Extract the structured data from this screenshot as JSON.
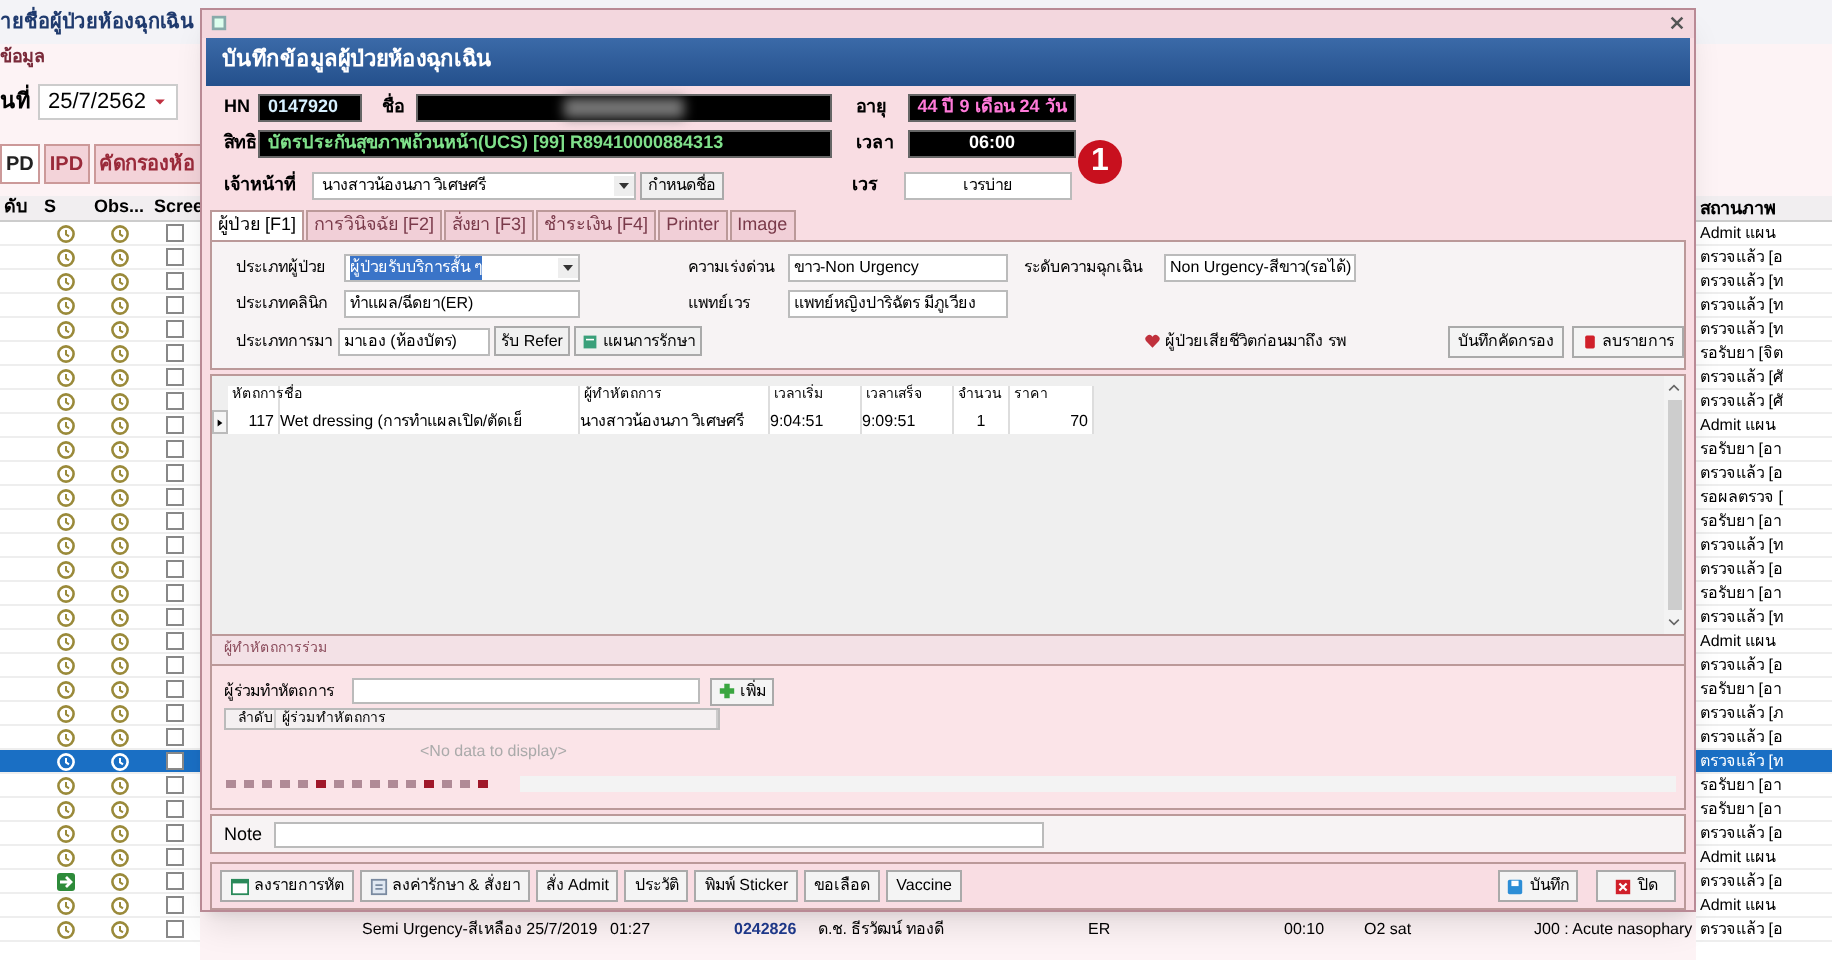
{
  "app": {
    "title": "ายชื่อผู้ป่วยห้องฉุกเฉิน",
    "menu": "ข้อมูล",
    "date_label": "นที่",
    "date": "25/7/2562",
    "tabs": [
      {
        "label": "PD",
        "selected": true
      },
      {
        "label": "IPD",
        "selected": false
      },
      {
        "label": "คัดกรองห้อ",
        "selected": false
      }
    ],
    "columns": [
      "ดับ",
      "S",
      "Obs...",
      "Scree"
    ],
    "status_column": "สถานภาพ",
    "rows": [
      {
        "kind": "clock",
        "checked": false,
        "selected": false,
        "status": "Admit แผน"
      },
      {
        "kind": "clock",
        "checked": false,
        "selected": false,
        "status": "ตรวจแล้ว [อ"
      },
      {
        "kind": "clock",
        "checked": false,
        "selected": false,
        "status": "ตรวจแล้ว [ท"
      },
      {
        "kind": "clock",
        "checked": false,
        "selected": false,
        "status": "ตรวจแล้ว [ท"
      },
      {
        "kind": "clock",
        "checked": false,
        "selected": false,
        "status": "ตรวจแล้ว [ท"
      },
      {
        "kind": "clock",
        "checked": false,
        "selected": false,
        "status": "รอรับยา [จิต"
      },
      {
        "kind": "clock",
        "checked": false,
        "selected": false,
        "status": "ตรวจแล้ว [ศั"
      },
      {
        "kind": "clock",
        "checked": false,
        "selected": false,
        "status": "ตรวจแล้ว [ศั"
      },
      {
        "kind": "clock",
        "checked": false,
        "selected": false,
        "status": "Admit แผน"
      },
      {
        "kind": "clock",
        "checked": false,
        "selected": false,
        "status": "รอรับยา [อา"
      },
      {
        "kind": "clock",
        "checked": false,
        "selected": false,
        "status": "ตรวจแล้ว [อ"
      },
      {
        "kind": "clock",
        "checked": false,
        "selected": false,
        "status": "รอผลตรวจ ["
      },
      {
        "kind": "clock",
        "checked": false,
        "selected": false,
        "status": "รอรับยา [อา"
      },
      {
        "kind": "clock",
        "checked": false,
        "selected": false,
        "status": "ตรวจแล้ว [ท"
      },
      {
        "kind": "clock",
        "checked": false,
        "selected": false,
        "status": "ตรวจแล้ว [อ"
      },
      {
        "kind": "clock",
        "checked": false,
        "selected": false,
        "status": "รอรับยา [อา"
      },
      {
        "kind": "clock",
        "checked": false,
        "selected": false,
        "status": "ตรวจแล้ว [ท"
      },
      {
        "kind": "clock",
        "checked": false,
        "selected": false,
        "status": "Admit แผน"
      },
      {
        "kind": "clock",
        "checked": false,
        "selected": false,
        "status": "ตรวจแล้ว [อ"
      },
      {
        "kind": "clock",
        "checked": false,
        "selected": false,
        "status": "รอรับยา [อา"
      },
      {
        "kind": "clock",
        "checked": false,
        "selected": false,
        "status": "ตรวจแล้ว [ภ"
      },
      {
        "kind": "clock",
        "checked": false,
        "selected": false,
        "status": "ตรวจแล้ว [อ"
      },
      {
        "kind": "clock",
        "checked": false,
        "selected": true,
        "status": "ตรวจแล้ว [ท"
      },
      {
        "kind": "clock",
        "checked": false,
        "selected": false,
        "status": "รอรับยา [อา"
      },
      {
        "kind": "clock",
        "checked": false,
        "selected": false,
        "status": "รอรับยา [อา"
      },
      {
        "kind": "clock",
        "checked": false,
        "selected": false,
        "status": "ตรวจแล้ว [อ"
      },
      {
        "kind": "clock",
        "checked": false,
        "selected": false,
        "status": "Admit แผน"
      },
      {
        "kind": "arrow",
        "checked": false,
        "selected": false,
        "status": "ตรวจแล้ว [อ"
      },
      {
        "kind": "clock",
        "checked": false,
        "selected": false,
        "status": "Admit แผน"
      },
      {
        "kind": "clock",
        "checked": false,
        "selected": false,
        "status": "ตรวจแล้ว [อ",
        "cells": [
          "Semi Urgency-สีเหลือง 25/7/2019",
          "01:27",
          "0242826",
          "ด.ช. ธีรวัฒน์ ทองดี",
          "ER",
          "00:10",
          "O2 sat",
          "J00 : Acute nasophary"
        ]
      }
    ]
  },
  "dialog": {
    "header": "บันทึกข้อมูลผู้ป่วยห้องฉุกเฉิน",
    "hn_label": "HN",
    "hn": "0147920",
    "name_label": "ชื่อ",
    "age_label": "อายุ",
    "age": "44 ปี 9 เดือน 24 วัน",
    "right_label": "สิทธิ",
    "right": "บัตรประกันสุขภาพถ้วนหน้า(UCS) [99] R89410000884313",
    "time_label": "เวลา",
    "time": "06:00",
    "staff_label": "เจ้าหน้าที่",
    "staff": "นางสาวน้องนภา วิเศษศรี",
    "staff_button": "กำหนดชื่อ",
    "shift_label": "เวร",
    "shift": "เวรบ่าย",
    "badge": "1",
    "tabs": [
      {
        "label": "ผู้ป่วย [F1]",
        "selected": true
      },
      {
        "label": "การวินิจฉัย [F2]",
        "selected": false
      },
      {
        "label": "สั่งยา [F3]",
        "selected": false
      },
      {
        "label": "ชำระเงิน [F4]",
        "selected": false
      },
      {
        "label": "Printer",
        "selected": false
      },
      {
        "label": "Image",
        "selected": false
      }
    ],
    "patient_type_label": "ประเภทผู้ป่วย",
    "patient_type": "ผู้ป่วยรับบริการสั้น ๆ",
    "urgency_label": "ความเร่งด่วน",
    "urgency": "ขาว-Non  Urgency",
    "level_label": "ระดับความฉุกเฉิน",
    "level_value": "Non Urgency-สีขาว(รอได้)",
    "clinic_label": "ประเภทคลินิก",
    "clinic": "ทำแผล/ฉีดยา(ER)",
    "doctor_label": "แพทย์เวร",
    "doctor": "แพทย์หญิงปาริฉัตร มีภูเวียง",
    "arrival_label": "ประเภทการมา",
    "arrival": "มาเอง (ห้องบัตร)",
    "refer_button": "รับ Refer",
    "plan_button": "แผนการรักษา",
    "dead_label": "ผู้ป่วยเสียชีวิตก่อนมาถึง รพ",
    "screen_button": "บันทึกคัดกรอง",
    "delete_button": "ลบรายการ",
    "procedures": {
      "columns": [
        "หัตถการ",
        "ชื่อ",
        "ผู้ทำหัตถการ",
        "เวลาเริ่ม",
        "เวลาเสร็จ",
        "จำนวน",
        "ราคา"
      ],
      "rows": [
        {
          "current": true,
          "cells": [
            "117",
            "Wet dressing (การทำแผลเปิด/ตัดเย็",
            "นางสาวน้องนภา วิเศษศรี",
            "9:04:51",
            "9:09:51",
            "1",
            "70"
          ]
        }
      ]
    },
    "assistants": {
      "title": "ผู้ทำหัตถการร่วม",
      "field_label": "ผู้ร่วมทำหัตถการ",
      "add_button": "เพิ่ม",
      "columns": [
        "ลำดับ",
        "ผู้ร่วมทำหัตถการ"
      ],
      "empty": "<No data to display>"
    },
    "note_label": "Note",
    "actions": [
      {
        "label": "ลงรายการหัต"
      },
      {
        "label": "ลงค่ารักษา & สั่งยา"
      },
      {
        "label": "สั่ง Admit"
      },
      {
        "label": "ประวัติ"
      },
      {
        "label": "พิมพ์ Sticker"
      },
      {
        "label": "ขอเลือด"
      },
      {
        "label": "Vaccine"
      }
    ],
    "save_button": "บันทึก",
    "close_button": "ปิด"
  }
}
